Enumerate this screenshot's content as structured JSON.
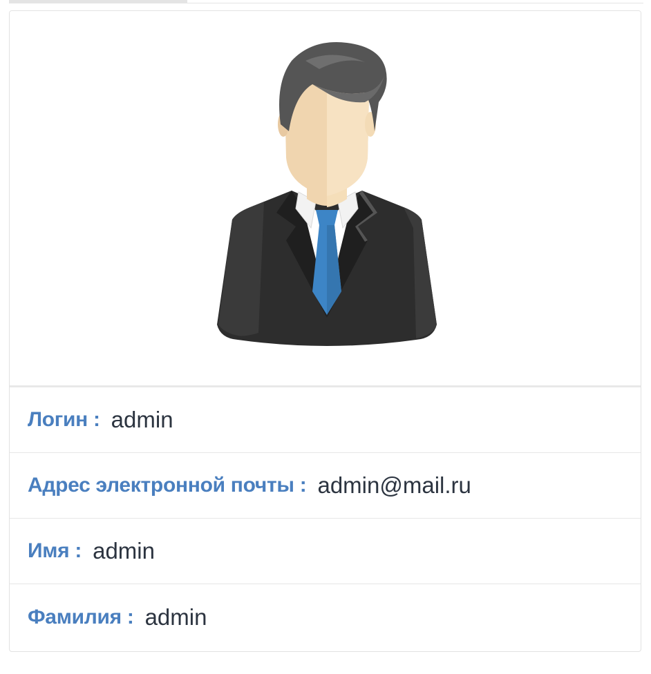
{
  "profile": {
    "avatar_icon": "user-avatar-icon",
    "fields": [
      {
        "label": "Логин :",
        "value": "admin"
      },
      {
        "label": "Адрес электронной почты :",
        "value": "admin@mail.ru"
      },
      {
        "label": "Имя :",
        "value": "admin"
      },
      {
        "label": "Фамилия :",
        "value": "admin"
      }
    ]
  },
  "colors": {
    "label": "#4a7fbf",
    "value": "#2c3440",
    "tie": "#3d85c6",
    "suit": "#2d2d2d",
    "hair": "#555555",
    "skin": "#f5deb9"
  }
}
